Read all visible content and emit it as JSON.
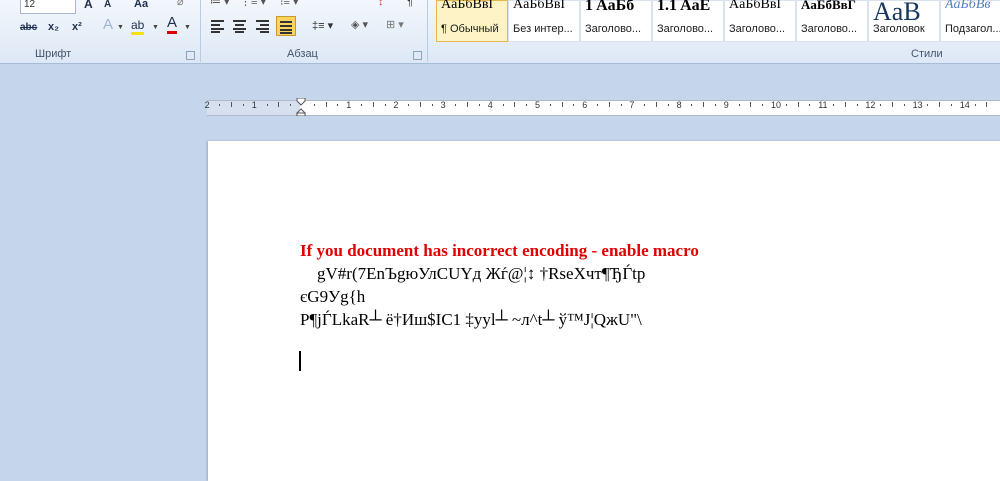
{
  "ribbon": {
    "font_group": {
      "label": "Шрифт",
      "font_size": "12",
      "grow_font": "A",
      "shrink_font": "A",
      "change_case": "Aa",
      "strikethrough": "abc",
      "subscript": "x₂",
      "superscript": "x²",
      "highlight_color": "#f5e10e",
      "font_color": "#e00000"
    },
    "paragraph_group": {
      "label": "Абзац"
    },
    "styles_group": {
      "label": "Стили",
      "items": [
        {
          "sample": "AaБбВвI",
          "name": "¶ Обычный",
          "selected": true,
          "sample_size": "14px",
          "sample_weight": "normal",
          "sample_color": "#000000"
        },
        {
          "sample": "AaБбВвI",
          "name": "Без интер...",
          "selected": false,
          "sample_size": "14px",
          "sample_weight": "normal",
          "sample_color": "#000000"
        },
        {
          "sample": "1 AaБб",
          "name": "Заголово...",
          "selected": false,
          "sample_size": "16px",
          "sample_weight": "bold",
          "sample_color": "#000000"
        },
        {
          "sample": "1.1 AaE",
          "name": "Заголово...",
          "selected": false,
          "sample_size": "16px",
          "sample_weight": "bold",
          "sample_color": "#000000"
        },
        {
          "sample": "AaБбВвI",
          "name": "Заголово...",
          "selected": false,
          "sample_size": "14px",
          "sample_weight": "normal",
          "sample_color": "#000000"
        },
        {
          "sample": "AaБбВвГ",
          "name": "Заголово...",
          "selected": false,
          "sample_size": "13px",
          "sample_weight": "bold",
          "sample_color": "#000000"
        },
        {
          "sample": "AaB",
          "name": "Заголовок",
          "selected": false,
          "sample_size": "26px",
          "sample_weight": "normal",
          "sample_color": "#17365d"
        },
        {
          "sample": "AaБбВв",
          "name": "Подзагол...",
          "selected": false,
          "sample_size": "14px",
          "sample_weight": "normal",
          "sample_color": "#4f81bd"
        }
      ]
    }
  },
  "ruler": {
    "left_labels": [
      "2",
      "1"
    ],
    "right_labels": [
      "1",
      "2",
      "3",
      "4",
      "5",
      "6",
      "7",
      "8",
      "9",
      "10",
      "11",
      "12",
      "13",
      "14"
    ]
  },
  "document": {
    "title": "If you document has incorrect encoding - enable macro",
    "lines": [
      "    gV#r(7EnЪgюУлCUYд Жѓ@¦↕ †RseXчт¶ЂЃtp",
      "єG9Уg{h",
      "P¶jЃLkaR┴ ё†Иш$IC1 ‡yyl┴ ~л^t┴ ў™J¦QжU\"\\"
    ]
  }
}
